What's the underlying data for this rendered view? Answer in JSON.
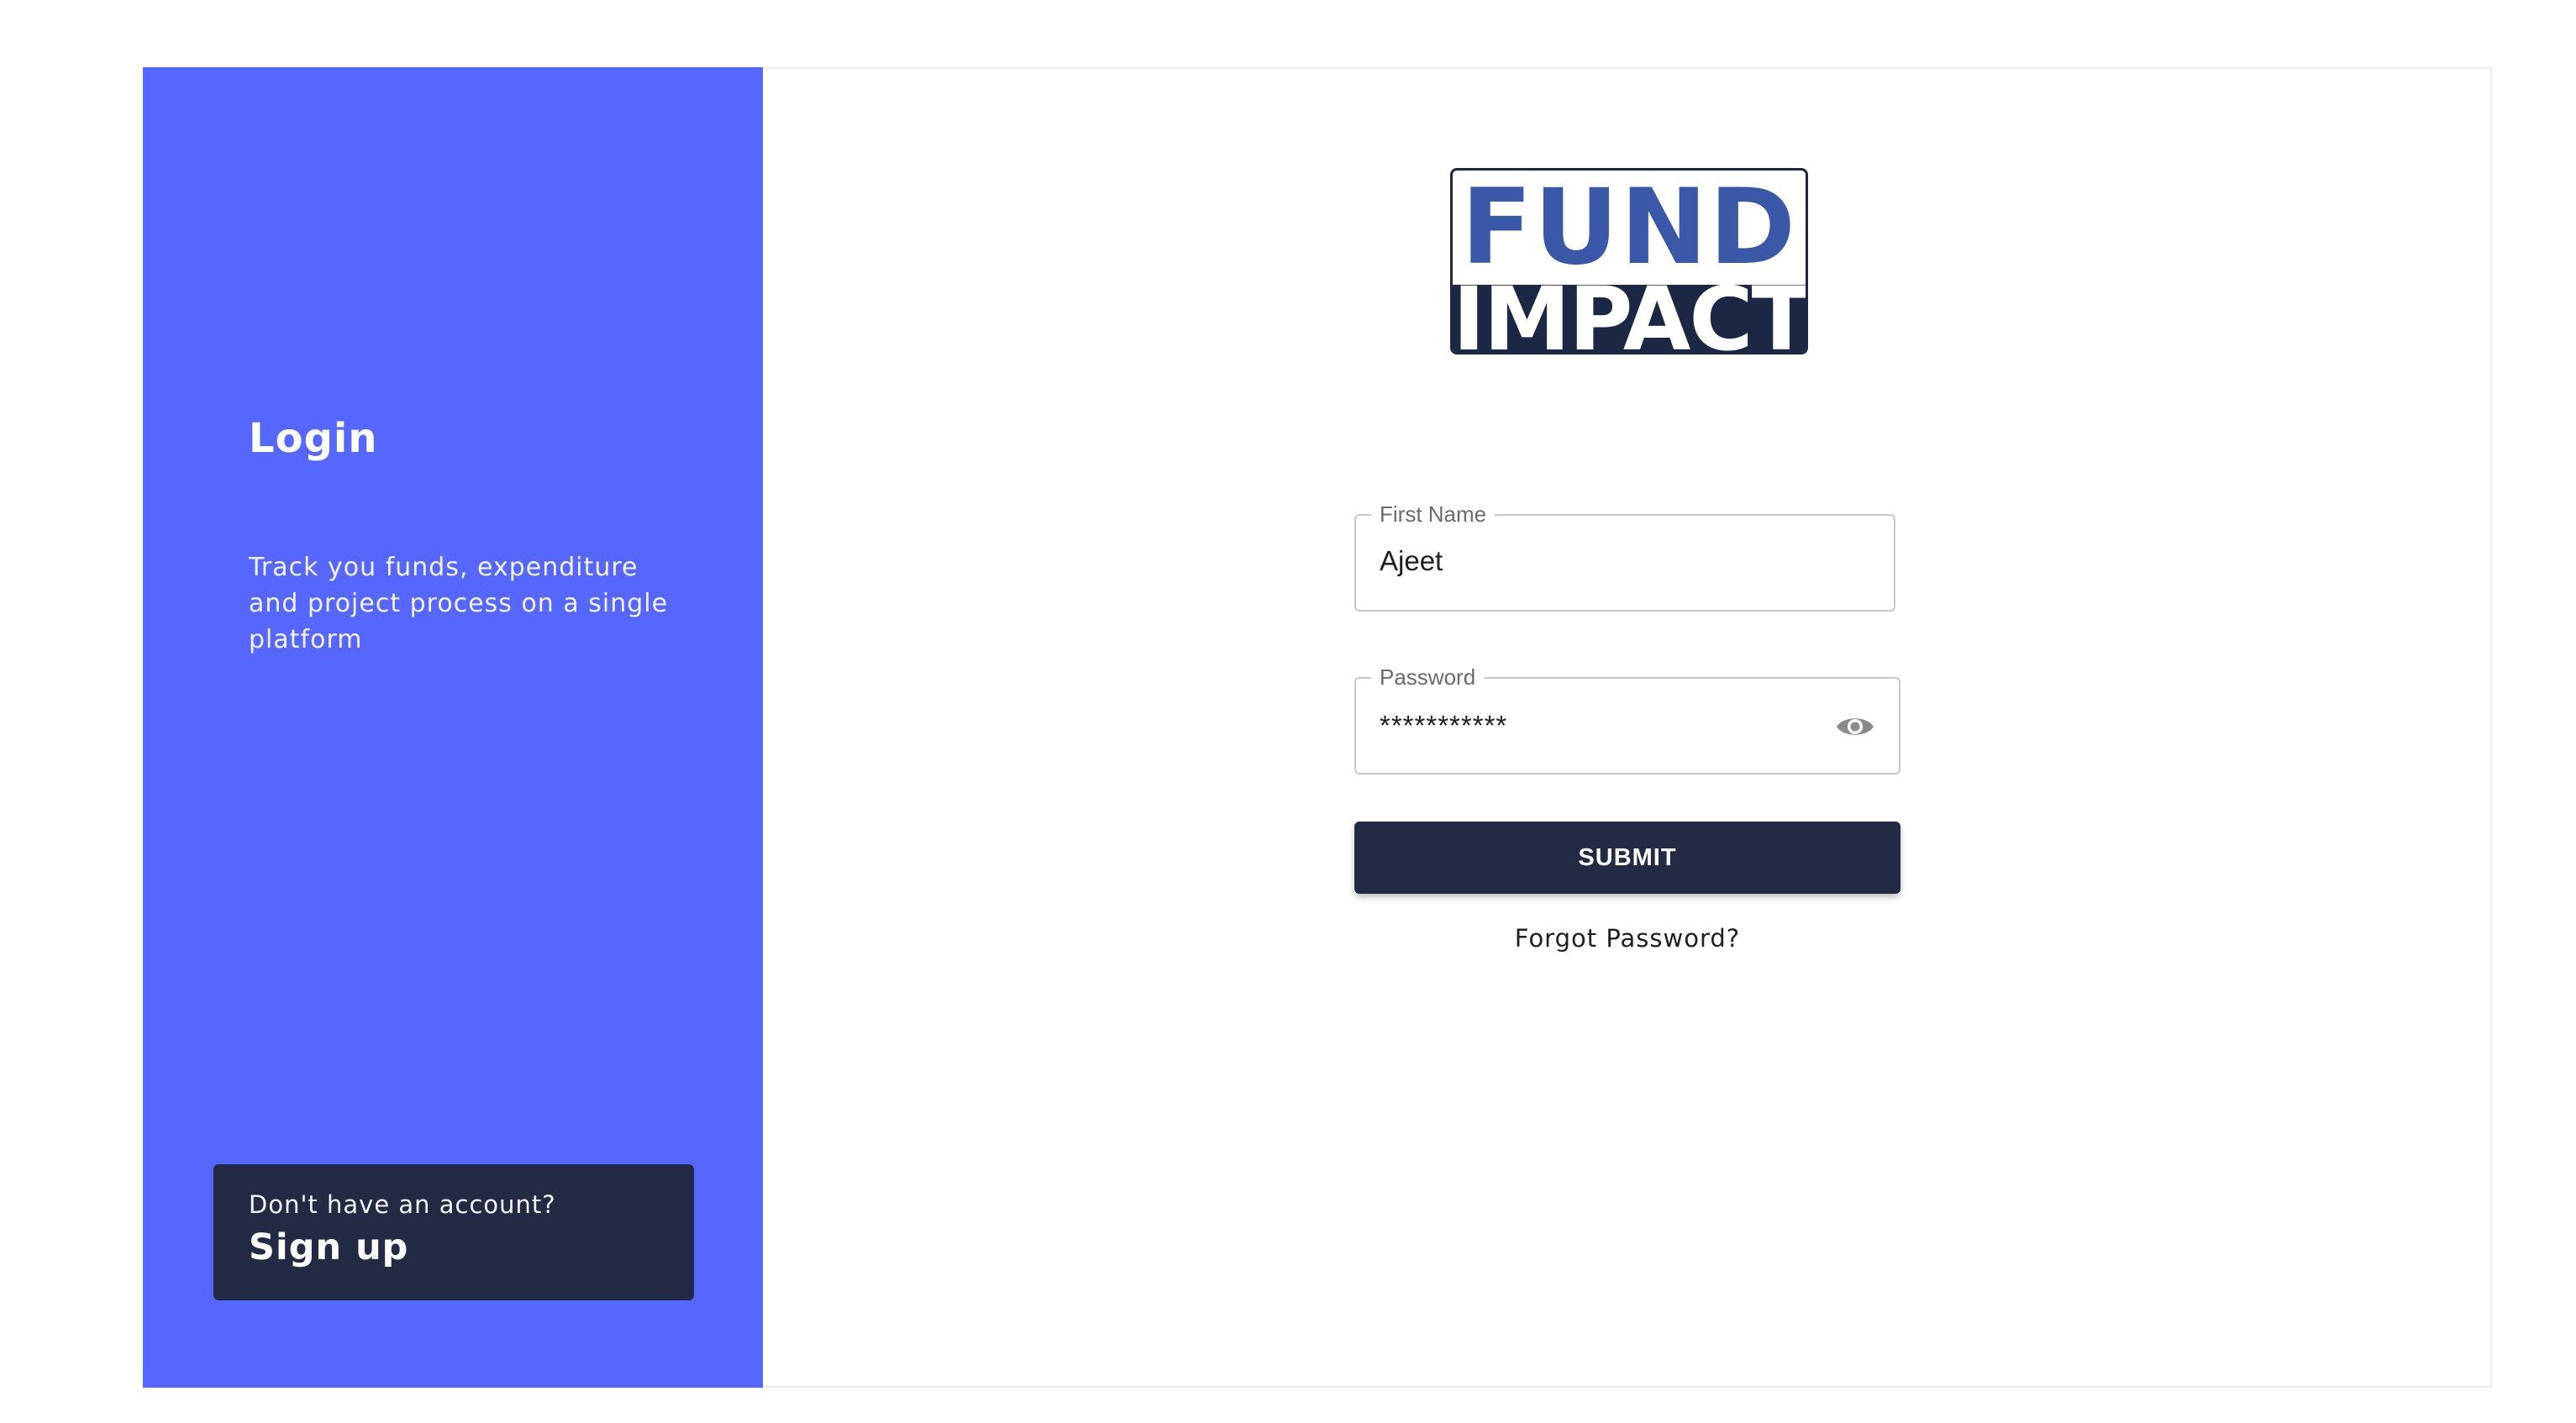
{
  "sidebar": {
    "title": "Login",
    "description": "Track you funds, expenditure and project process on a single platform",
    "signup_prompt": "Don't have an account?",
    "signup_label": "Sign up"
  },
  "logo": {
    "top_text": "FUND",
    "bottom_text": "IMPACT"
  },
  "form": {
    "first_name": {
      "label": "First Name",
      "value": "Ajeet"
    },
    "password": {
      "label": "Password",
      "value": "***********",
      "toggle_icon": "eye-icon"
    },
    "submit_label": "SUBMIT",
    "forgot_label": "Forgot Password?"
  },
  "colors": {
    "sidebar_bg": "#5567ff",
    "dark_navy": "#232a44",
    "logo_blue": "#3a57a8"
  }
}
